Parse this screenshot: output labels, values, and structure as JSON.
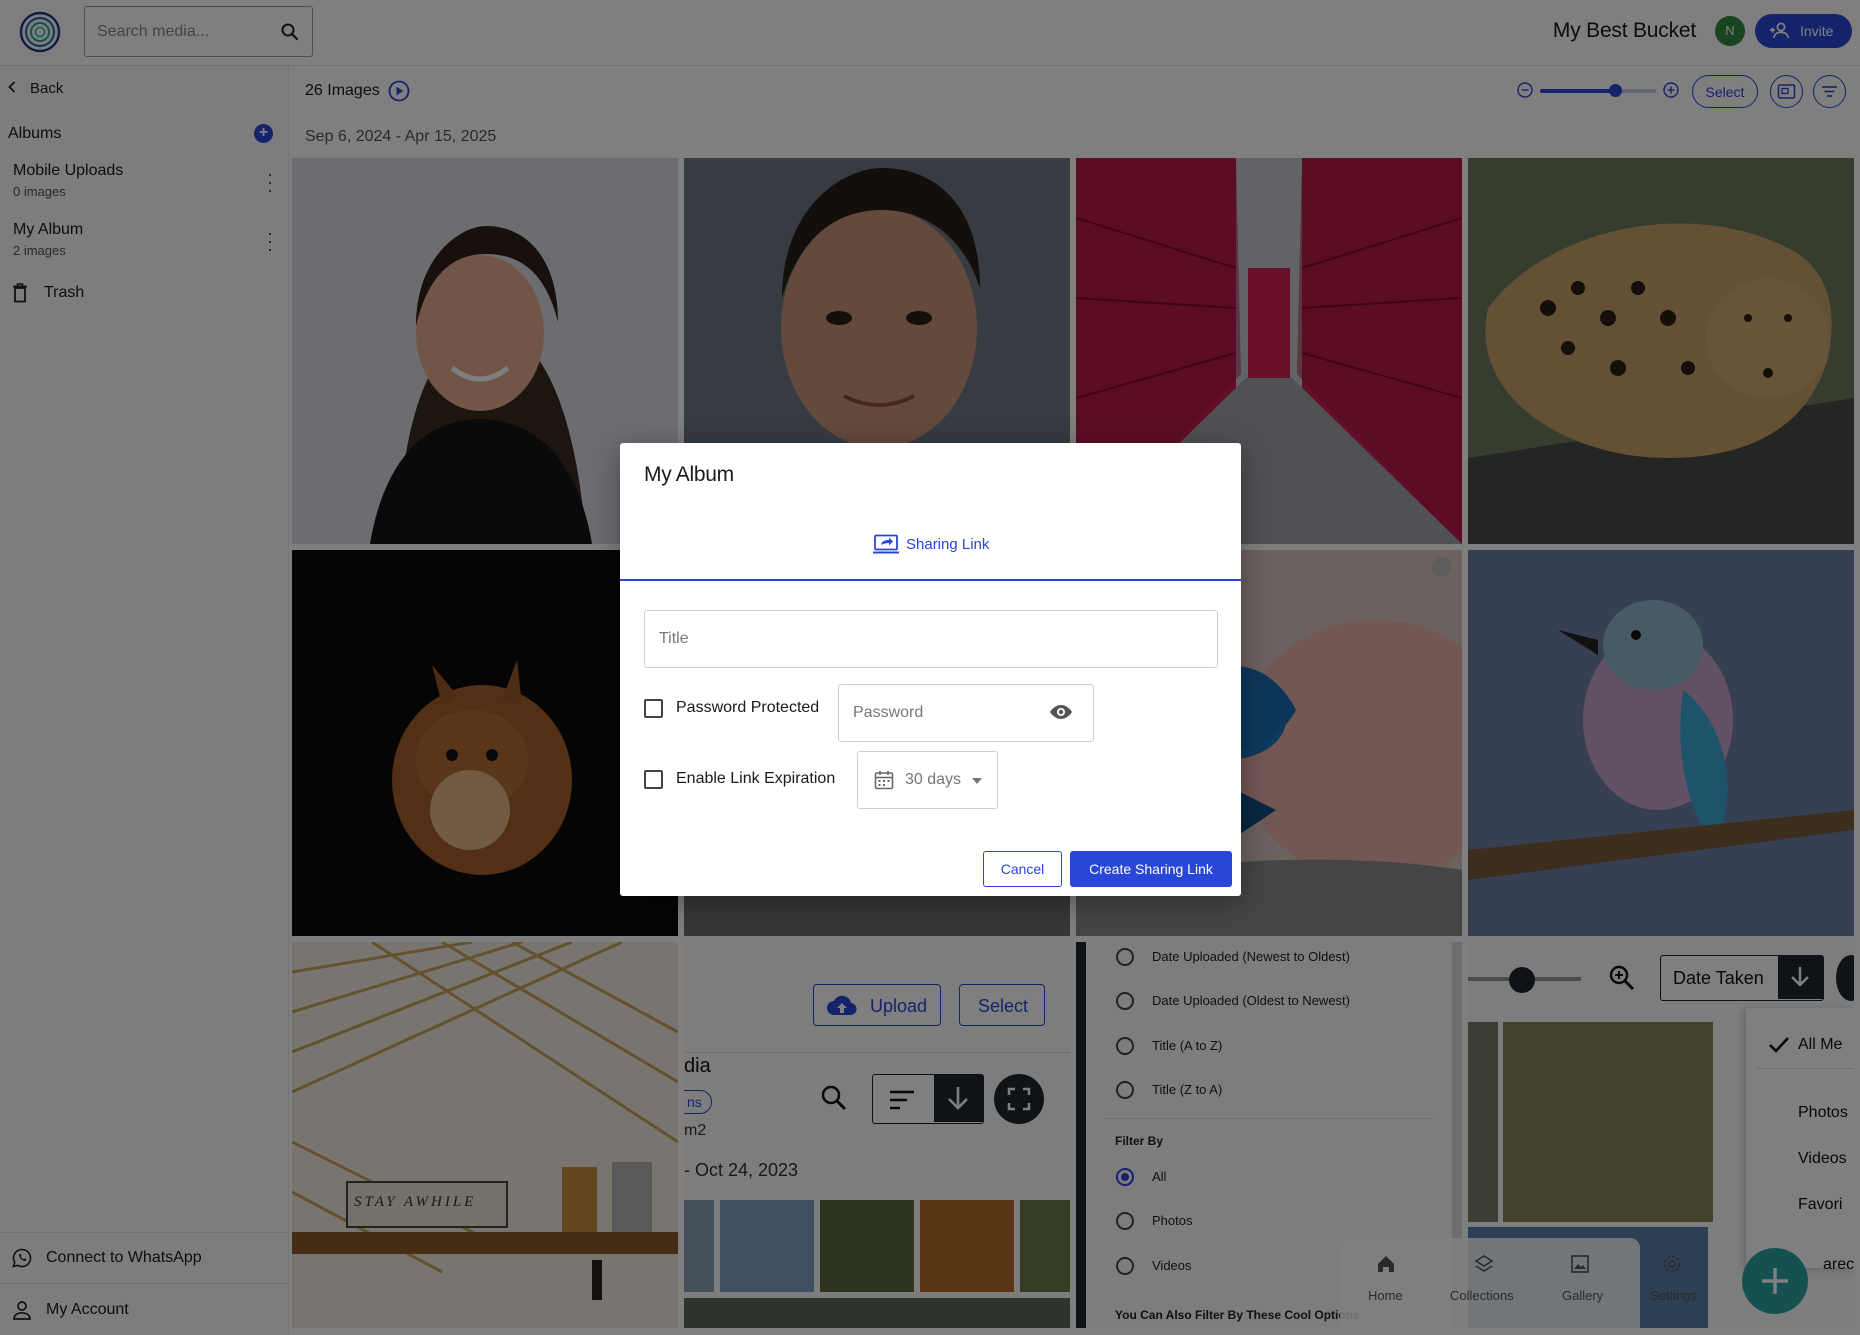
{
  "header": {
    "search_placeholder": "Search media...",
    "bucket_name": "My Best Bucket",
    "avatar_initial": "N",
    "invite_label": "Invite"
  },
  "sidebar": {
    "back_label": "Back",
    "albums_label": "Albums",
    "albums": [
      {
        "name": "Mobile Uploads",
        "count": "0 images"
      },
      {
        "name": "My Album",
        "count": "2 images"
      }
    ],
    "trash_label": "Trash",
    "footer": [
      {
        "label": "Connect to WhatsApp"
      },
      {
        "label": "My Account"
      }
    ]
  },
  "toolbar": {
    "image_count": "26 Images",
    "date_range": "Sep 6, 2024 - Apr 15, 2025",
    "zoom_level": 0.65,
    "select_label": "Select"
  },
  "collage": {
    "upload_label": "Upload",
    "select_label": "Select",
    "media_partial": "dia",
    "chip_partial": "ns",
    "album_partial": "m2",
    "date_partial": "- Oct 24, 2023",
    "sort_options": [
      "Date Uploaded (Newest to Oldest)",
      "Date Uploaded (Oldest to Newest)",
      "Title (A to Z)",
      "Title (Z to A)"
    ],
    "filter_by_label": "Filter By",
    "filter_options": [
      "All",
      "Photos",
      "Videos"
    ],
    "filter_footer": "You Can Also Filter By These Cool Options",
    "date_taken_label": "Date Taken",
    "menu_items": [
      "All Me",
      "Photos",
      "Videos",
      "Favori"
    ],
    "menu_partial": "arec",
    "nav_items": [
      "Home",
      "Collections",
      "Gallery",
      "Settings"
    ],
    "sign_text": "STAY AWHILE"
  },
  "modal": {
    "title": "My Album",
    "tab_label": "Sharing Link",
    "title_placeholder": "Title",
    "password_protected_label": "Password Protected",
    "password_placeholder": "Password",
    "link_expiration_label": "Enable Link Expiration",
    "expiration_value": "30 days",
    "cancel_label": "Cancel",
    "create_label": "Create Sharing Link"
  },
  "colors": {
    "accent": "#2946d6",
    "avatar": "#2e8b3e",
    "overlay": "rgba(0,0,0,0.5)"
  }
}
